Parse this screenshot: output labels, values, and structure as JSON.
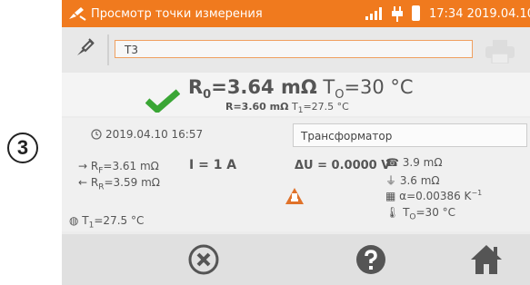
{
  "callout": "3",
  "status": {
    "title": "Просмотр точки измерения",
    "datetime": "17:34 2019.04.10",
    "icons": [
      "probe-icon",
      "signal-icon",
      "plug-icon",
      "battery-icon"
    ]
  },
  "toolbar": {
    "name_value": "T3",
    "icons": [
      "probe-icon",
      "printer-icon"
    ]
  },
  "main": {
    "r0_label": "R",
    "r0_sub": "0",
    "r0_value": "=3.64 mΩ",
    "t0_label": "T",
    "t0_sub": "O",
    "t0_value": "=30 °C",
    "r_line": "R=3.60 mΩ",
    "t1_label": "T",
    "t1_sub": "1",
    "t1_value": "=27.5 °C"
  },
  "details": {
    "date": "2019.04.10 16:57",
    "object": "Трансформатор",
    "rf_label": "R",
    "rf_sub": "F",
    "rf_value": "=3.61 mΩ",
    "rr_label": "R",
    "rr_sub": "R",
    "rr_value": "=3.59 mΩ",
    "current": "I = 1 A",
    "delta_u": "ΔU = 0.0000 V",
    "r1": "3.9 mΩ",
    "r2": "3.6 mΩ",
    "alpha": "α=0.00386 K",
    "alpha_sup": "−1",
    "t0_label": "T",
    "t0_sub": "O",
    "t0_value": "=30 °C",
    "t1_label": "T",
    "t1_sub": "1",
    "t1_value": "=27.5 °C"
  },
  "bottom": {
    "buttons": [
      "close-button",
      "help-button",
      "home-button"
    ]
  },
  "colors": {
    "status_bar": "#f07a1e",
    "check": "#3aa635",
    "warning": "#e0722a",
    "icon_dark": "#555555"
  }
}
